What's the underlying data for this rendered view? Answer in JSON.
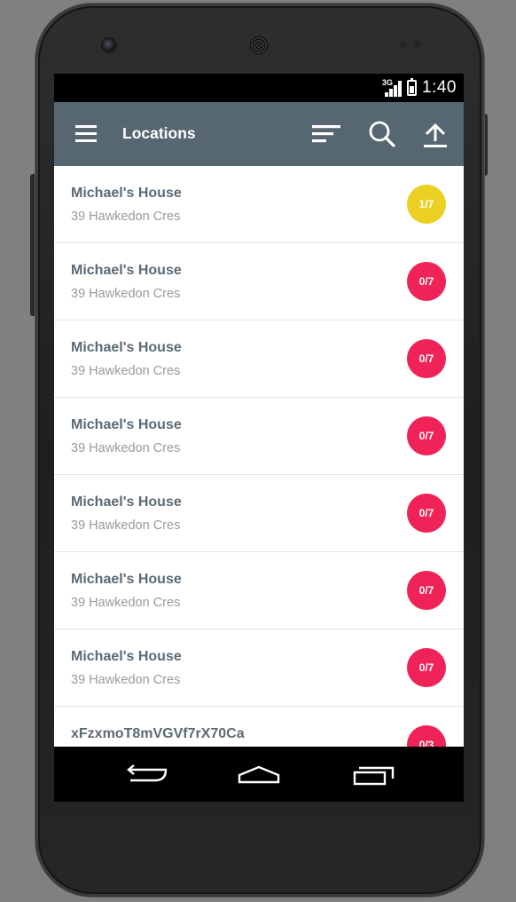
{
  "status_bar": {
    "network": "3G",
    "time": "1:40",
    "icons": [
      "signal-icon",
      "battery-charging-icon"
    ]
  },
  "toolbar": {
    "title": "Locations",
    "background": "#566772",
    "actions": [
      {
        "name": "menu-icon"
      },
      {
        "name": "sort-icon"
      },
      {
        "name": "search-icon"
      },
      {
        "name": "upload-icon"
      }
    ]
  },
  "badge_colors": {
    "partial": "#ebd023",
    "none": "#ef2357"
  },
  "locations": [
    {
      "name": "Michael's House",
      "address": "39 Hawkedon Cres",
      "progress": "1/7",
      "status": "partial"
    },
    {
      "name": "Michael's House",
      "address": "39 Hawkedon Cres",
      "progress": "0/7",
      "status": "none"
    },
    {
      "name": "Michael's House",
      "address": "39 Hawkedon Cres",
      "progress": "0/7",
      "status": "none"
    },
    {
      "name": "Michael's House",
      "address": "39 Hawkedon Cres",
      "progress": "0/7",
      "status": "none"
    },
    {
      "name": "Michael's House",
      "address": "39 Hawkedon Cres",
      "progress": "0/7",
      "status": "none"
    },
    {
      "name": "Michael's House",
      "address": "39 Hawkedon Cres",
      "progress": "0/7",
      "status": "none"
    },
    {
      "name": "Michael's House",
      "address": "39 Hawkedon Cres",
      "progress": "0/7",
      "status": "none"
    },
    {
      "name": "xFzxmoT8mVGVf7rX70Ca",
      "address": "",
      "progress": "0/3",
      "status": "none"
    }
  ],
  "nav_bar": {
    "buttons": [
      "back-icon",
      "home-icon",
      "recents-icon"
    ]
  }
}
